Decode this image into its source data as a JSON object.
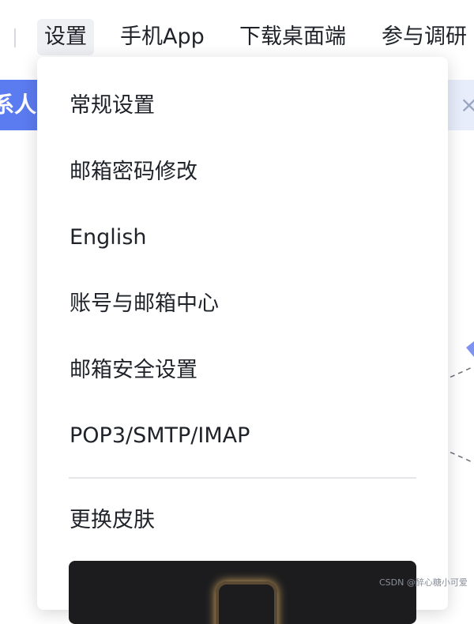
{
  "nav": {
    "items": [
      "设置",
      "手机App",
      "下载桌面端",
      "参与调研"
    ]
  },
  "banner": {
    "left_text": "系人邮",
    "close_glyph": "×"
  },
  "menu": {
    "items": [
      "常规设置",
      "邮箱密码修改",
      "English",
      "账号与邮箱中心",
      "邮箱安全设置",
      "POP3/SMTP/IMAP"
    ],
    "skin_label": "更换皮肤"
  },
  "watermark": "CSDN @醉心糖小可爱",
  "colors": {
    "accent": "#5b7bf0",
    "banner_bg": "#e7edfb",
    "active_nav_bg": "#eef0f3",
    "text": "#1f2329"
  }
}
